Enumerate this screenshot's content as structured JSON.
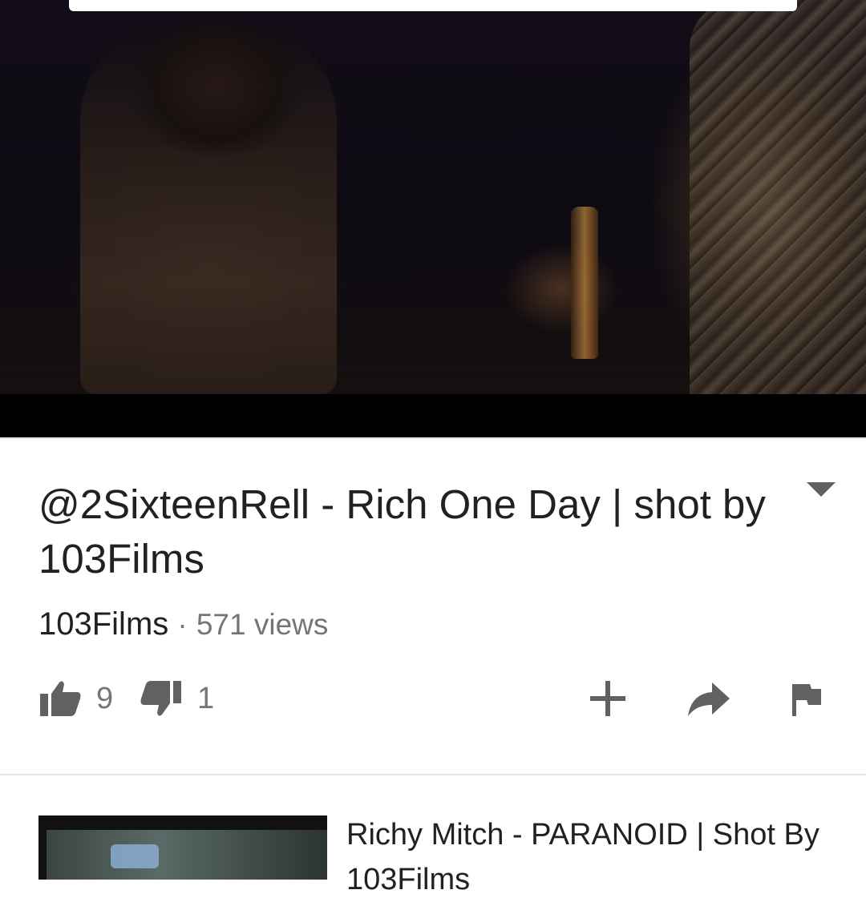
{
  "video": {
    "title": "@2SixteenRell - Rich One Day | shot by 103Films",
    "channel": "103Films",
    "separator": "·",
    "views": "571 views",
    "likes": "9",
    "dislikes": "1"
  },
  "icons": {
    "expand": "chevron-down-icon",
    "like": "thumbs-up-icon",
    "dislike": "thumbs-down-icon",
    "add": "add-to-playlist-icon",
    "share": "share-icon",
    "flag": "flag-icon"
  },
  "related": [
    {
      "title": "Richy Mitch - PARANOID | Shot By 103Films"
    }
  ],
  "colors": {
    "text_primary": "#212121",
    "text_secondary": "#757575",
    "icon_gray": "#616161"
  }
}
